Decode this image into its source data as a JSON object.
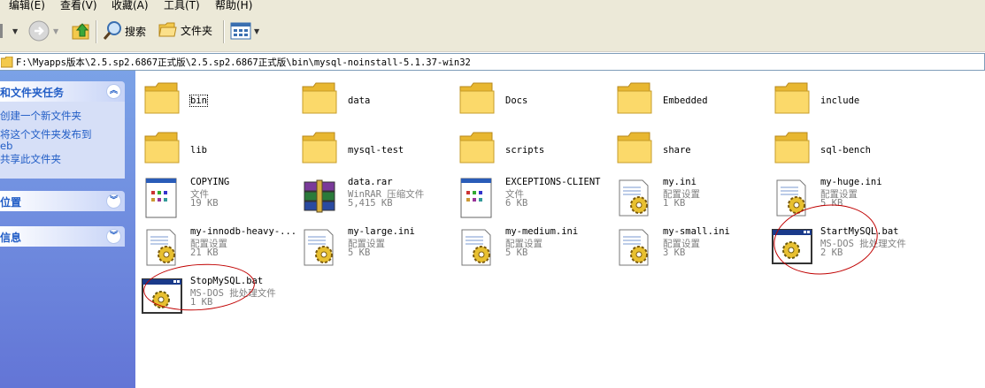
{
  "menu": [
    "编辑(E)",
    "查看(V)",
    "收藏(A)",
    "工具(T)",
    "帮助(H)"
  ],
  "toolbar": {
    "search": "搜索",
    "folders": "文件夹"
  },
  "address": {
    "path": "F:\\Myapps版本\\2.5.sp2.6867正式版\\2.5.sp2.6867正式版\\bin\\mysql-noinstall-5.1.37-win32"
  },
  "left_pane": {
    "panels": [
      {
        "title": "和文件夹任务",
        "tasks": [
          "创建一个新文件夹",
          "将这个文件夹发布到",
          "eb",
          "共享此文件夹"
        ]
      },
      {
        "title": "位置"
      },
      {
        "title": "信息"
      }
    ]
  },
  "files": [
    {
      "name": "bin",
      "type": "folder"
    },
    {
      "name": "data",
      "type": "folder"
    },
    {
      "name": "Docs",
      "type": "folder"
    },
    {
      "name": "Embedded",
      "type": "folder"
    },
    {
      "name": "include",
      "type": "folder"
    },
    {
      "name": "lib",
      "type": "folder"
    },
    {
      "name": "mysql-test",
      "type": "folder"
    },
    {
      "name": "scripts",
      "type": "folder"
    },
    {
      "name": "share",
      "type": "folder"
    },
    {
      "name": "sql-bench",
      "type": "folder"
    },
    {
      "name": "COPYING",
      "kind": "文件",
      "size": "19 KB",
      "type": "doc"
    },
    {
      "name": "data.rar",
      "kind": "WinRAR 压缩文件",
      "size": "5,415 KB",
      "type": "rar"
    },
    {
      "name": "EXCEPTIONS-CLIENT",
      "kind": "文件",
      "size": "6 KB",
      "type": "doc"
    },
    {
      "name": "my.ini",
      "kind": "配置设置",
      "size": "1 KB",
      "type": "ini"
    },
    {
      "name": "my-huge.ini",
      "kind": "配置设置",
      "size": "5 KB",
      "type": "ini"
    },
    {
      "name": "my-innodb-heavy-...",
      "kind": "配置设置",
      "size": "21 KB",
      "type": "ini"
    },
    {
      "name": "my-large.ini",
      "kind": "配置设置",
      "size": "5 KB",
      "type": "ini"
    },
    {
      "name": "my-medium.ini",
      "kind": "配置设置",
      "size": "5 KB",
      "type": "ini"
    },
    {
      "name": "my-small.ini",
      "kind": "配置设置",
      "size": "3 KB",
      "type": "ini"
    },
    {
      "name": "StartMySQL.bat",
      "kind": "MS-DOS 批处理文件",
      "size": "2 KB",
      "type": "bat"
    },
    {
      "name": "StopMySQL.bat",
      "kind": "MS-DOS 批处理文件",
      "size": "1 KB",
      "type": "bat"
    }
  ],
  "colors": {
    "task_pane_top": "#7ba2e7",
    "task_pane_bottom": "#6375d6",
    "task_link": "#215dc6",
    "annotation": "#c00000"
  }
}
